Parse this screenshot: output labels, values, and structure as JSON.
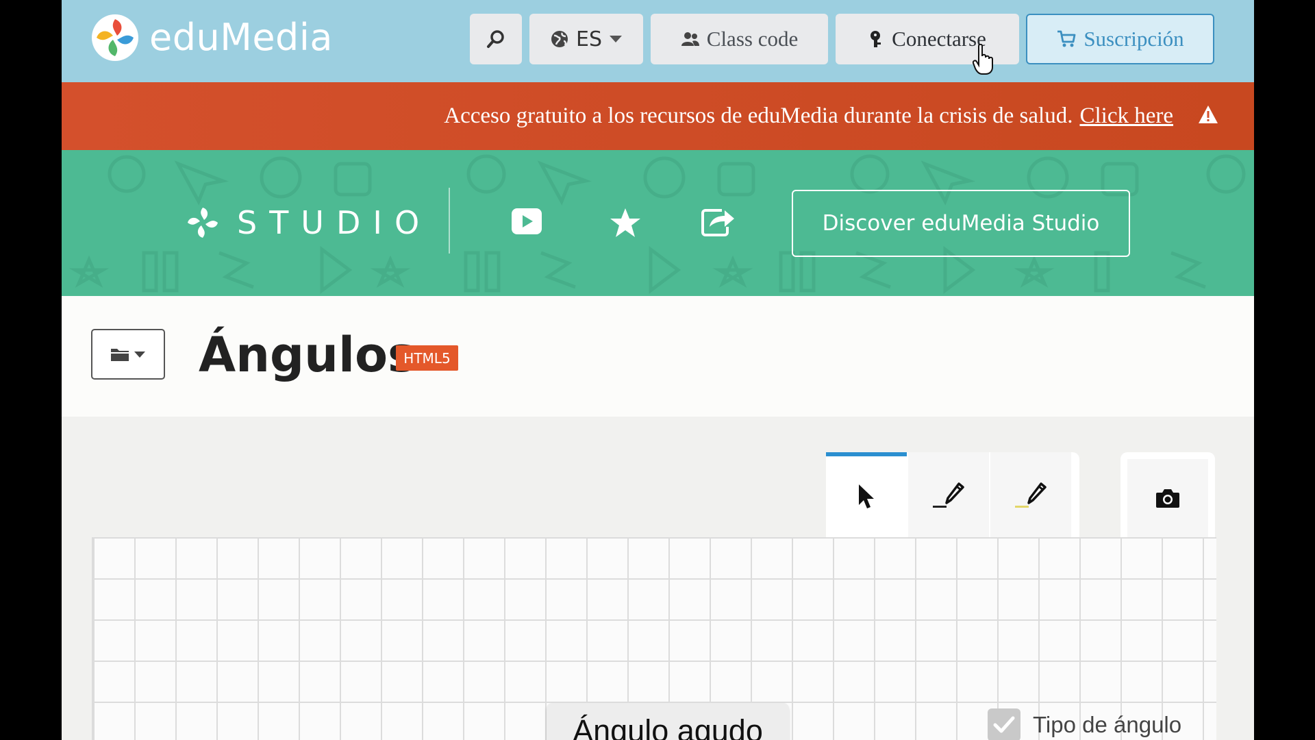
{
  "header": {
    "logo_text": "eduMedia",
    "language": "ES",
    "class_code_label": "Class code",
    "login_label": "Conectarse",
    "subscribe_label": "Suscripción",
    "icons": [
      "search-icon",
      "globe-icon",
      "chevron-down-icon",
      "users-icon",
      "key-icon",
      "cart-icon"
    ]
  },
  "alert": {
    "message": "Acceso gratuito a los recursos de eduMedia durante la crisis de salud.",
    "link_label": "Click here",
    "icon": "warning-icon"
  },
  "studio": {
    "wordmark": "STUDIO",
    "discover_label": "Discover eduMedia Studio",
    "icons": [
      "video-icon",
      "star-icon",
      "share-icon"
    ]
  },
  "title": {
    "text": "Ángulos",
    "badge": "HTML5"
  },
  "simulation": {
    "tools": [
      "pointer-icon",
      "pen-dark-icon",
      "pen-yellow-icon",
      "camera-icon"
    ],
    "active_tool": "pointer",
    "angle_label": "Ángulo agudo",
    "checkbox_label": "Tipo de ángulo",
    "checkbox_checked": true
  },
  "colors": {
    "header_bg": "#9ccfe0",
    "alert_bg": "#d4502c",
    "studio_bg": "#4dba93",
    "badge_bg": "#e4582a",
    "accent": "#3b8fc0"
  }
}
